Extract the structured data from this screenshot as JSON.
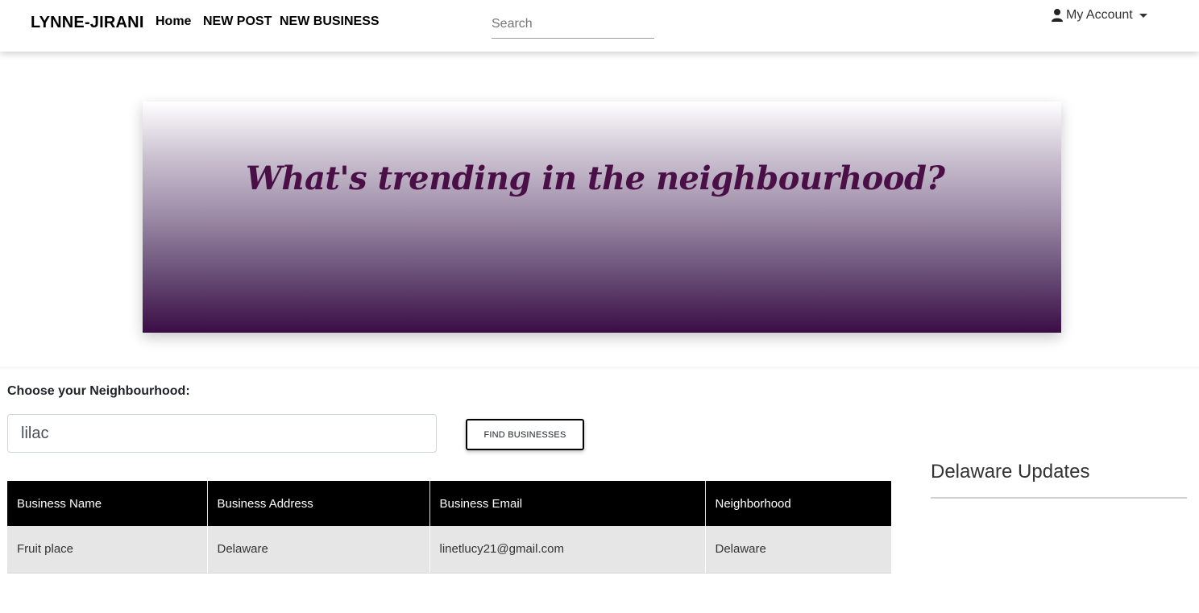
{
  "navbar": {
    "brand": "LYNNE-JIRANI",
    "links": [
      "Home",
      "NEW POST",
      "NEW BUSINESS"
    ],
    "search_placeholder": "Search",
    "account_label": "My Account"
  },
  "hero": {
    "title": "What's trending in the neighbourhood?"
  },
  "form": {
    "label": "Choose your Neighbourhood:",
    "input_value": "lilac",
    "button_label": "FIND BUSINESSES"
  },
  "table": {
    "headers": [
      "Business Name",
      "Business Address",
      "Business Email",
      "Neighborhood"
    ],
    "rows": [
      [
        "Fruit place",
        "Delaware",
        "linetlucy21@gmail.com",
        "Delaware"
      ]
    ]
  },
  "sidebar": {
    "title": "Delaware Updates"
  },
  "colors": {
    "hero_text": "#4a0f47",
    "hero_gradient_end": "#3a0d45",
    "table_header": "#000000"
  }
}
